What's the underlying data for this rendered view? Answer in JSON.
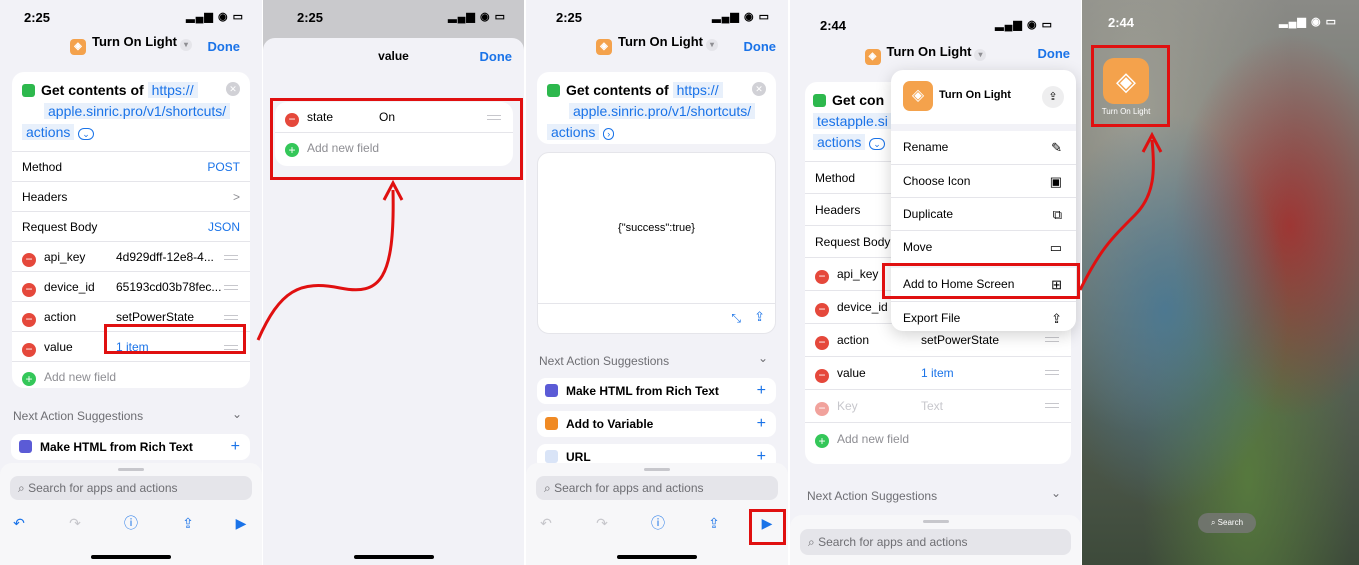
{
  "panel1": {
    "time": "2:25",
    "title": "Turn On Light",
    "done": "Done",
    "get_contents": "Get contents of",
    "url_part1": "https://",
    "url_part2": "apple.sinric.pro/v1/shortcuts/",
    "url_part3": "actions",
    "rows": [
      {
        "label": "Method",
        "value": "POST"
      },
      {
        "label": "Headers",
        "value": ">"
      },
      {
        "label": "Request Body",
        "value": "JSON"
      }
    ],
    "fields": [
      {
        "key": "api_key",
        "value": "4d929dff-12e8-4..."
      },
      {
        "key": "device_id",
        "value": "65193cd03b78fec..."
      },
      {
        "key": "action",
        "value": "setPowerState"
      },
      {
        "key": "value",
        "value": "1 item"
      }
    ],
    "add_field": "Add new field",
    "next_suggestions": "Next Action Suggestions",
    "suggestion1": "Make HTML from Rich Text",
    "search_placeholder": "Search for apps and actions"
  },
  "panel2": {
    "time": "2:25",
    "title": "value",
    "done": "Done",
    "field_key": "state",
    "field_value": "On",
    "add_field": "Add new field"
  },
  "panel3": {
    "time": "2:25",
    "title": "Turn On Light",
    "done": "Done",
    "get_contents": "Get contents of",
    "url_part1": "https://",
    "url_part2": "apple.sinric.pro/v1/shortcuts/",
    "url_part3": "actions",
    "result": "{\"success\":true}",
    "next_suggestions": "Next Action Suggestions",
    "suggestions": [
      "Make HTML from Rich Text",
      "Add to Variable",
      "URL"
    ],
    "search_placeholder": "Search for apps and actions"
  },
  "panel4": {
    "time": "2:44",
    "title": "Turn On Light",
    "done": "Done",
    "get_contents": "Get con",
    "url_part1": "testapple.si",
    "url_part3": "actions",
    "rows": [
      "Method",
      "Headers",
      "Request Body"
    ],
    "fields": [
      {
        "key": "api_key",
        "value": ""
      },
      {
        "key": "device_id",
        "value": ""
      },
      {
        "key": "action",
        "value": "setPowerState"
      },
      {
        "key": "value",
        "value": "1 item"
      },
      {
        "key": "Key",
        "value": "Text"
      }
    ],
    "add_field": "Add new field",
    "next_suggestions": "Next Action Suggestions",
    "search_placeholder": "Search for apps and actions",
    "menu": {
      "header": "Turn On Light",
      "items": [
        {
          "label": "Rename",
          "icon": "✎"
        },
        {
          "label": "Choose Icon",
          "icon": "▣"
        },
        {
          "label": "Duplicate",
          "icon": "⧉"
        },
        {
          "label": "Move",
          "icon": "▭"
        },
        {
          "label": "Add to Home Screen",
          "icon": "⊞"
        },
        {
          "label": "Export File",
          "icon": "⇪"
        }
      ]
    }
  },
  "panel5": {
    "time": "2:44",
    "app_label": "Turn On Light",
    "search": "Search"
  },
  "colors": {
    "accent": "#1a73e8",
    "highlight": "#e01010",
    "shortcut_icon": "#f4a24c"
  }
}
